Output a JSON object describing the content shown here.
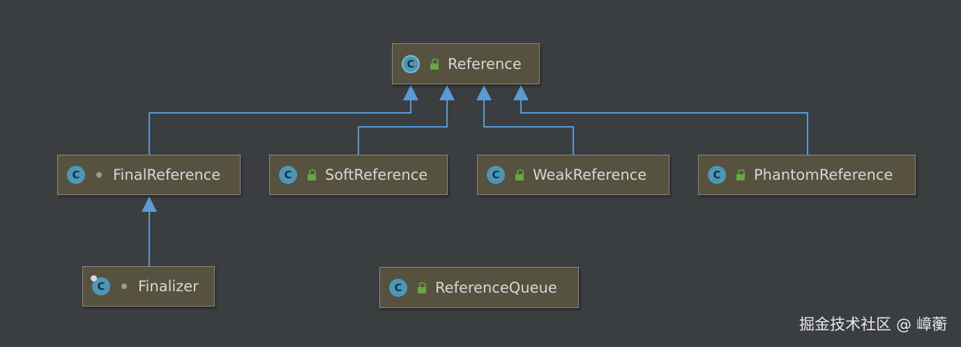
{
  "diagram": {
    "nodes": {
      "reference": {
        "label": "Reference",
        "icon": "class-icon",
        "visibility": "public"
      },
      "final_reference": {
        "label": "FinalReference",
        "icon": "class-icon",
        "visibility": "package-private"
      },
      "soft_reference": {
        "label": "SoftReference",
        "icon": "class-icon",
        "visibility": "public"
      },
      "weak_reference": {
        "label": "WeakReference",
        "icon": "class-icon",
        "visibility": "public"
      },
      "phantom_reference": {
        "label": "PhantomReference",
        "icon": "class-icon",
        "visibility": "public"
      },
      "finalizer": {
        "label": "Finalizer",
        "icon": "class-icon",
        "visibility": "package-private",
        "modifier": "final"
      },
      "reference_queue": {
        "label": "ReferenceQueue",
        "icon": "class-icon",
        "visibility": "public"
      }
    },
    "edges": [
      {
        "from": "final_reference",
        "to": "reference",
        "type": "extends"
      },
      {
        "from": "soft_reference",
        "to": "reference",
        "type": "extends"
      },
      {
        "from": "weak_reference",
        "to": "reference",
        "type": "extends"
      },
      {
        "from": "phantom_reference",
        "to": "reference",
        "type": "extends"
      },
      {
        "from": "finalizer",
        "to": "final_reference",
        "type": "extends"
      }
    ],
    "icon_letter": "C",
    "colors": {
      "background": "#3b3e40",
      "node_fill": "#56523f",
      "node_border": "#8d8a7a",
      "edge": "#5b9bd5",
      "class_icon": "#4a97b8",
      "lock": "#6aa648"
    }
  },
  "watermark": "掘金技术社区 @ 嶂蘅"
}
